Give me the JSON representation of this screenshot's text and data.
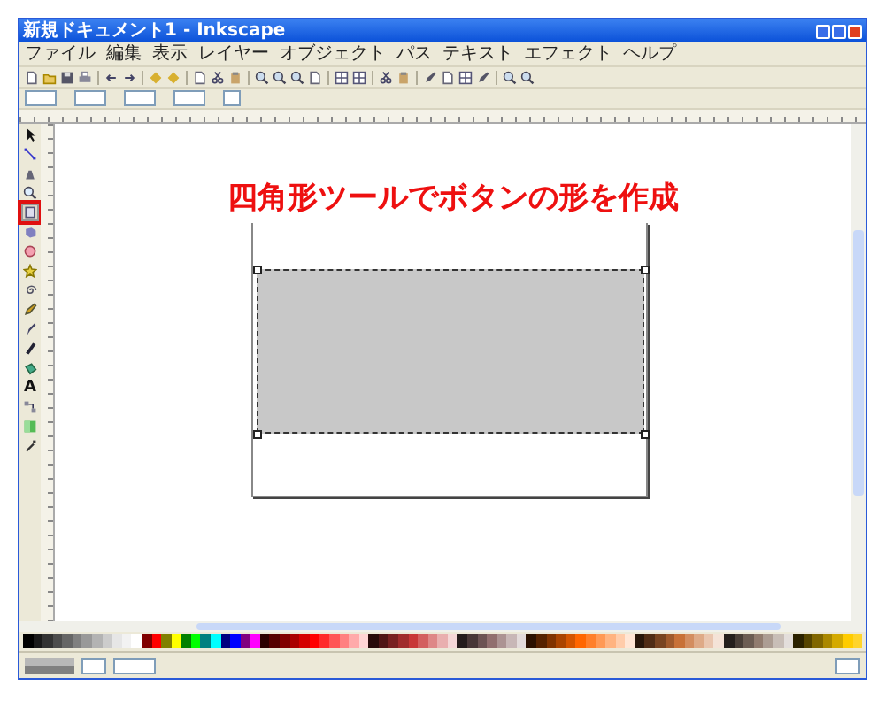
{
  "window": {
    "title": "新規ドキュメント1 - Inkscape"
  },
  "menu": [
    "ファイル",
    "編集",
    "表示",
    "レイヤー",
    "オブジェクト",
    "パス",
    "テキスト",
    "エフェクト",
    "ヘルプ"
  ],
  "tools": [
    {
      "kind": "selector",
      "selected": false,
      "highlighted": false
    },
    {
      "kind": "node",
      "selected": false,
      "highlighted": false
    },
    {
      "kind": "tweak",
      "selected": false,
      "highlighted": false
    },
    {
      "kind": "zoom",
      "selected": false,
      "highlighted": false
    },
    {
      "kind": "rect",
      "selected": true,
      "highlighted": true
    },
    {
      "kind": "box",
      "selected": false,
      "highlighted": false
    },
    {
      "kind": "ellipse",
      "selected": false,
      "highlighted": false
    },
    {
      "kind": "star",
      "selected": false,
      "highlighted": false
    },
    {
      "kind": "spiral",
      "selected": false,
      "highlighted": false
    },
    {
      "kind": "pencil",
      "selected": false,
      "highlighted": false
    },
    {
      "kind": "pen",
      "selected": false,
      "highlighted": false
    },
    {
      "kind": "calligraphy",
      "selected": false,
      "highlighted": false
    },
    {
      "kind": "bucket",
      "selected": false,
      "highlighted": false
    },
    {
      "kind": "text",
      "label": "A",
      "selected": false,
      "highlighted": false
    },
    {
      "kind": "connector",
      "selected": false,
      "highlighted": false
    },
    {
      "kind": "gradient",
      "selected": false,
      "highlighted": false
    },
    {
      "kind": "dropper",
      "selected": false,
      "highlighted": false
    }
  ],
  "canvas": {
    "caption": "四角形ツールでボタンの形を作成",
    "shape": {
      "selected": true
    }
  },
  "palette": [
    {
      "color": "#000000"
    },
    {
      "color": "#1a1a1a"
    },
    {
      "color": "#333333"
    },
    {
      "color": "#4d4d4d"
    },
    {
      "color": "#666666"
    },
    {
      "color": "#808080"
    },
    {
      "color": "#999999"
    },
    {
      "color": "#b3b3b3"
    },
    {
      "color": "#cccccc"
    },
    {
      "color": "#e6e6e6"
    },
    {
      "color": "#f2f2f2"
    },
    {
      "color": "#ffffff"
    },
    {
      "color": "#800000"
    },
    {
      "color": "#ff0000"
    },
    {
      "color": "#808000"
    },
    {
      "color": "#ffff00"
    },
    {
      "color": "#008000"
    },
    {
      "color": "#00ff00"
    },
    {
      "color": "#008080"
    },
    {
      "color": "#00ffff"
    },
    {
      "color": "#000080"
    },
    {
      "color": "#0000ff"
    },
    {
      "color": "#800080"
    },
    {
      "color": "#ff00ff"
    },
    {
      "color": "#2b0000"
    },
    {
      "color": "#550000"
    },
    {
      "color": "#800000"
    },
    {
      "color": "#aa0000"
    },
    {
      "color": "#d40000"
    },
    {
      "color": "#ff0000"
    },
    {
      "color": "#ff2a2a"
    },
    {
      "color": "#ff5555"
    },
    {
      "color": "#ff8080"
    },
    {
      "color": "#ffaaaa"
    },
    {
      "color": "#ffd5d5"
    },
    {
      "color": "#280b0b"
    },
    {
      "color": "#501616"
    },
    {
      "color": "#782121"
    },
    {
      "color": "#a02c2c"
    },
    {
      "color": "#c83737"
    },
    {
      "color": "#d35f5f"
    },
    {
      "color": "#de8787"
    },
    {
      "color": "#e9afaf"
    },
    {
      "color": "#f4d7d7"
    },
    {
      "color": "#241c1c"
    },
    {
      "color": "#483737"
    },
    {
      "color": "#6c5353"
    },
    {
      "color": "#916f6f"
    },
    {
      "color": "#ac9393"
    },
    {
      "color": "#c8b7b7"
    },
    {
      "color": "#e3dbdb"
    },
    {
      "color": "#2b1100"
    },
    {
      "color": "#552200"
    },
    {
      "color": "#803300"
    },
    {
      "color": "#aa4400"
    },
    {
      "color": "#d45500"
    },
    {
      "color": "#ff6600"
    },
    {
      "color": "#ff7f2a"
    },
    {
      "color": "#ff9955"
    },
    {
      "color": "#ffb380"
    },
    {
      "color": "#ffccaa"
    },
    {
      "color": "#ffe6d5"
    },
    {
      "color": "#28170b"
    },
    {
      "color": "#502d16"
    },
    {
      "color": "#784421"
    },
    {
      "color": "#a05a2c"
    },
    {
      "color": "#c87137"
    },
    {
      "color": "#d38d5f"
    },
    {
      "color": "#deaa87"
    },
    {
      "color": "#e9c6af"
    },
    {
      "color": "#f4e3d7"
    },
    {
      "color": "#241f1c"
    },
    {
      "color": "#483e37"
    },
    {
      "color": "#6c5d53"
    },
    {
      "color": "#917c6f"
    },
    {
      "color": "#ac9d93"
    },
    {
      "color": "#c8beb7"
    },
    {
      "color": "#e3dedb"
    },
    {
      "color": "#2b2200"
    },
    {
      "color": "#554400"
    },
    {
      "color": "#806600"
    },
    {
      "color": "#aa8800"
    },
    {
      "color": "#d4aa00"
    },
    {
      "color": "#ffcc00"
    },
    {
      "color": "#ffd42a"
    }
  ]
}
